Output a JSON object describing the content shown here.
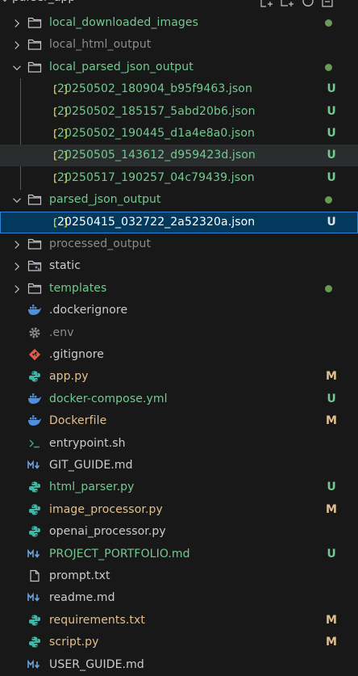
{
  "colors": {
    "modified": "#e2c08d",
    "untracked": "#73c991",
    "ignored": "#8c8c8c",
    "default": "#cccccc",
    "dot": "#6a9955",
    "selected_bg": "#04395e",
    "hover_bg": "#2a2d2e"
  },
  "header": {
    "title": "parser_app"
  },
  "tree": [
    {
      "label": "local_downloaded_images",
      "kind": "folder",
      "expanded": false,
      "depth": 0,
      "status": "untracked",
      "dot": true
    },
    {
      "label": "local_html_output",
      "kind": "folder",
      "expanded": false,
      "depth": 0,
      "status": "ignored"
    },
    {
      "label": "local_parsed_json_output",
      "kind": "folder",
      "expanded": true,
      "depth": 0,
      "status": "untracked",
      "dot": true
    },
    {
      "label": "20250502_180904_b95f9463.json",
      "kind": "json",
      "depth": 1,
      "status": "untracked",
      "badge": "U"
    },
    {
      "label": "20250502_185157_5abd20b6.json",
      "kind": "json",
      "depth": 1,
      "status": "untracked",
      "badge": "U"
    },
    {
      "label": "20250502_190445_d1a4e8a0.json",
      "kind": "json",
      "depth": 1,
      "status": "untracked",
      "badge": "U"
    },
    {
      "label": "20250505_143612_d959423d.json",
      "kind": "json",
      "depth": 1,
      "status": "untracked",
      "badge": "U",
      "hover": true
    },
    {
      "label": "20250517_190257_04c79439.json",
      "kind": "json",
      "depth": 1,
      "status": "untracked",
      "badge": "U"
    },
    {
      "label": "parsed_json_output",
      "kind": "folder",
      "expanded": true,
      "depth": 0,
      "status": "untracked",
      "dot": true
    },
    {
      "label": "20250415_032722_2a52320a.json",
      "kind": "json",
      "depth": 1,
      "status": "default",
      "badge": "U",
      "selected": true
    },
    {
      "label": "processed_output",
      "kind": "folder",
      "expanded": false,
      "depth": 0,
      "status": "ignored"
    },
    {
      "label": "static",
      "kind": "folder-static",
      "expanded": false,
      "depth": 0,
      "status": "default"
    },
    {
      "label": "templates",
      "kind": "folder",
      "expanded": false,
      "depth": 0,
      "status": "untracked",
      "dot": true
    },
    {
      "label": ".dockerignore",
      "kind": "docker",
      "depth": 0,
      "status": "default"
    },
    {
      "label": ".env",
      "kind": "gear",
      "depth": 0,
      "status": "ignored"
    },
    {
      "label": ".gitignore",
      "kind": "git",
      "depth": 0,
      "status": "default"
    },
    {
      "label": "app.py",
      "kind": "python",
      "depth": 0,
      "status": "modified",
      "badge": "M"
    },
    {
      "label": "docker-compose.yml",
      "kind": "docker",
      "depth": 0,
      "status": "untracked",
      "badge": "U"
    },
    {
      "label": "Dockerfile",
      "kind": "docker",
      "depth": 0,
      "status": "modified",
      "badge": "M"
    },
    {
      "label": "entrypoint.sh",
      "kind": "shell",
      "depth": 0,
      "status": "default"
    },
    {
      "label": "GIT_GUIDE.md",
      "kind": "markdown",
      "depth": 0,
      "status": "default"
    },
    {
      "label": "html_parser.py",
      "kind": "python",
      "depth": 0,
      "status": "untracked",
      "badge": "U"
    },
    {
      "label": "image_processor.py",
      "kind": "python",
      "depth": 0,
      "status": "modified",
      "badge": "M"
    },
    {
      "label": "openai_processor.py",
      "kind": "python",
      "depth": 0,
      "status": "default"
    },
    {
      "label": "PROJECT_PORTFOLIO.md",
      "kind": "markdown",
      "depth": 0,
      "status": "untracked",
      "badge": "U"
    },
    {
      "label": "prompt.txt",
      "kind": "text",
      "depth": 0,
      "status": "default"
    },
    {
      "label": "readme.md",
      "kind": "markdown",
      "depth": 0,
      "status": "default"
    },
    {
      "label": "requirements.txt",
      "kind": "python",
      "depth": 0,
      "status": "modified",
      "badge": "M"
    },
    {
      "label": "script.py",
      "kind": "python",
      "depth": 0,
      "status": "modified",
      "badge": "M"
    },
    {
      "label": "USER_GUIDE.md",
      "kind": "markdown",
      "depth": 0,
      "status": "default"
    }
  ]
}
